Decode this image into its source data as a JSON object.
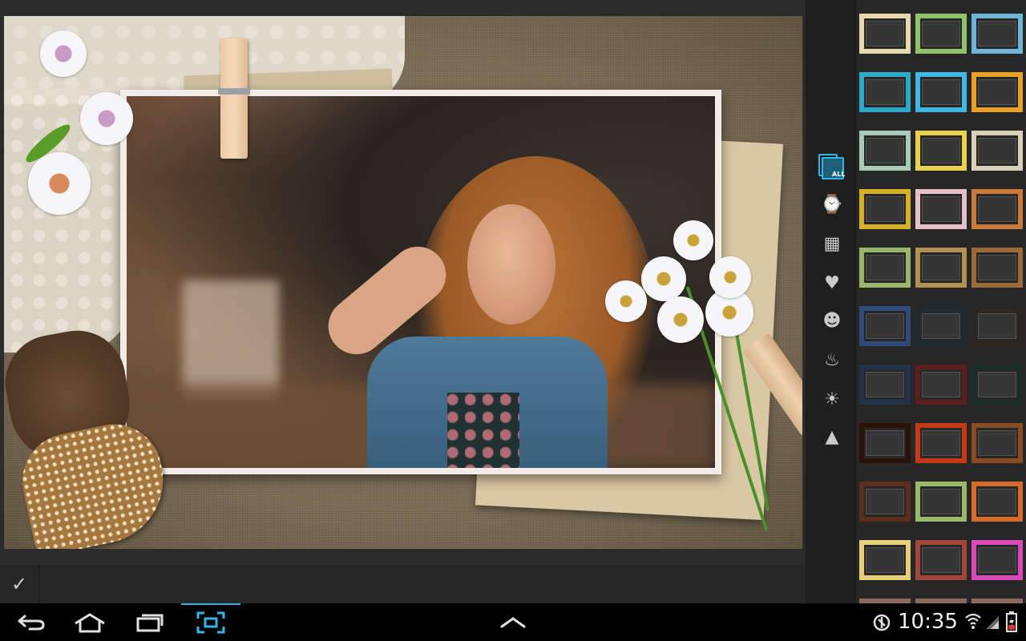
{
  "canvas": {
    "artwork": "scrapbook-photo-frame"
  },
  "action_bar": {
    "confirm_icon": "checkmark-icon",
    "confirm_glyph": "✓"
  },
  "categories": [
    {
      "name": "all",
      "icon": "all-frames-icon",
      "label": "ALL",
      "active": true
    },
    {
      "name": "recent",
      "icon": "recent-clock-icon",
      "glyph": "⌚"
    },
    {
      "name": "gallery",
      "icon": "photo-gallery-icon",
      "glyph": "▦"
    },
    {
      "name": "love",
      "icon": "heart-icon",
      "glyph": "♥"
    },
    {
      "name": "halloween",
      "icon": "pumpkin-icon",
      "glyph": "☻"
    },
    {
      "name": "birthday",
      "icon": "cake-icon",
      "glyph": "♨"
    },
    {
      "name": "summer",
      "icon": "sun-icon",
      "glyph": "☀"
    },
    {
      "name": "christmas",
      "icon": "christmas-tree-icon",
      "glyph": "▲"
    }
  ],
  "thumbnails": [
    {
      "row": 0,
      "col": 0,
      "color": "#e8d8b0"
    },
    {
      "row": 0,
      "col": 1,
      "color": "#8fc26a"
    },
    {
      "row": 0,
      "col": 2,
      "color": "#6fb5d8"
    },
    {
      "row": 1,
      "col": 0,
      "color": "#2fa7c9"
    },
    {
      "row": 1,
      "col": 1,
      "color": "#3fb8e6"
    },
    {
      "row": 1,
      "col": 2,
      "color": "#e8a22a"
    },
    {
      "row": 2,
      "col": 0,
      "color": "#a9c9b9"
    },
    {
      "row": 2,
      "col": 1,
      "color": "#e9d34c"
    },
    {
      "row": 2,
      "col": 2,
      "color": "#d8d0b8"
    },
    {
      "row": 3,
      "col": 0,
      "color": "#d6b02a"
    },
    {
      "row": 3,
      "col": 1,
      "color": "#e6c0c8"
    },
    {
      "row": 3,
      "col": 2,
      "color": "#c77a3a"
    },
    {
      "row": 4,
      "col": 0,
      "color": "#9bb66a"
    },
    {
      "row": 4,
      "col": 1,
      "color": "#b29052"
    },
    {
      "row": 4,
      "col": 2,
      "color": "#9c6a3a"
    },
    {
      "row": 5,
      "col": 0,
      "color": "#304a7a"
    },
    {
      "row": 5,
      "col": 1,
      "color": "#1e2a2e"
    },
    {
      "row": 5,
      "col": 2,
      "color": "#2a2622"
    },
    {
      "row": 6,
      "col": 0,
      "color": "#22324a"
    },
    {
      "row": 6,
      "col": 1,
      "color": "#5a1e1e"
    },
    {
      "row": 6,
      "col": 2,
      "color": "#1a2c26"
    },
    {
      "row": 7,
      "col": 0,
      "color": "#2a1208"
    },
    {
      "row": 7,
      "col": 1,
      "color": "#c43a12"
    },
    {
      "row": 7,
      "col": 2,
      "color": "#8a4a22"
    },
    {
      "row": 8,
      "col": 0,
      "color": "#5a2e1a"
    },
    {
      "row": 8,
      "col": 1,
      "color": "#9ab86a"
    },
    {
      "row": 8,
      "col": 2,
      "color": "#d66a2a"
    },
    {
      "row": 9,
      "col": 0,
      "color": "#e8d07a"
    },
    {
      "row": 9,
      "col": 1,
      "color": "#a0463a"
    },
    {
      "row": 9,
      "col": 2,
      "color": "#d84ab8"
    }
  ],
  "system_bar": {
    "nav": [
      {
        "name": "back",
        "icon": "back-icon"
      },
      {
        "name": "home",
        "icon": "home-icon"
      },
      {
        "name": "recent-apps",
        "icon": "recent-apps-icon"
      },
      {
        "name": "screenshot",
        "icon": "screenshot-icon",
        "active": true
      }
    ],
    "center_icon": "chevron-up-icon",
    "time": "10:35",
    "status_icons": [
      "data-saver-icon",
      "wifi-icon",
      "signal-icon",
      "battery-icon"
    ]
  },
  "colors": {
    "accent": "#33b5e5",
    "panel": "#272727",
    "system_bar": "#000000"
  }
}
